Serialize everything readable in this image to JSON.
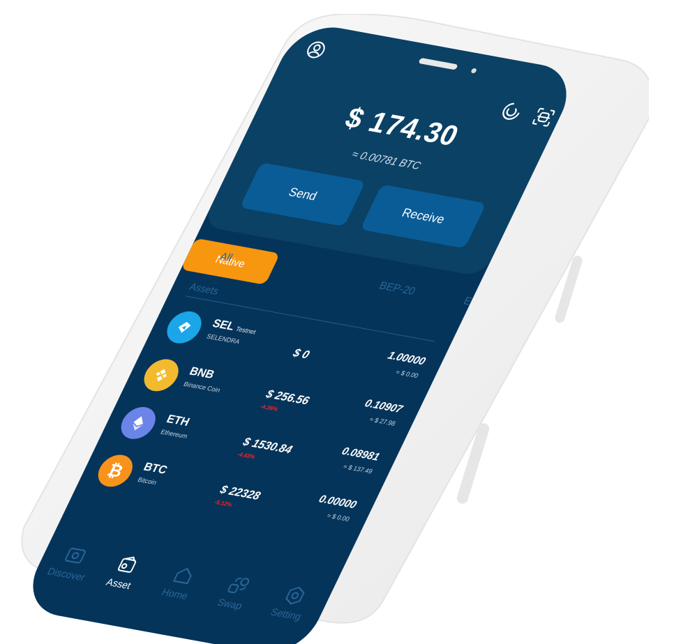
{
  "header": {
    "balance": "$ 174.30",
    "btc_equivalent": "≈ 0.00781 BTC"
  },
  "actions": {
    "send_label": "Send",
    "receive_label": "Receive"
  },
  "tabs": [
    {
      "label": "All",
      "active": false
    },
    {
      "label": "Native",
      "active": true
    },
    {
      "label": "BEP-20",
      "active": false
    },
    {
      "label": "ER",
      "active": false
    }
  ],
  "section_label": "Assets",
  "assets": [
    {
      "symbol": "SEL",
      "tag": "Testnet",
      "name": "SELENDRA",
      "price": "$ 0",
      "change": "",
      "amount": "1.00000",
      "value": "≈ $ 0.00",
      "icon": "selendra-icon",
      "color": "#1aa6e8"
    },
    {
      "symbol": "BNB",
      "tag": "",
      "name": "Binance Coin",
      "price": "$ 256.56",
      "change": "-4.26%",
      "amount": "0.10907",
      "value": "≈ $ 27.98",
      "icon": "binance-icon",
      "color": "#f3ba2f"
    },
    {
      "symbol": "ETH",
      "tag": "",
      "name": "Ethereum",
      "price": "$ 1530.84",
      "change": "-4.43%",
      "amount": "0.08981",
      "value": "≈ $ 137.49",
      "icon": "ethereum-icon",
      "color": "#6b84e8"
    },
    {
      "symbol": "BTC",
      "tag": "",
      "name": "Bitcoin",
      "price": "$ 22328",
      "change": "-5.12%",
      "amount": "0.00000",
      "value": "≈ $ 0.00",
      "icon": "bitcoin-icon",
      "color": "#f7931a"
    }
  ],
  "nav": [
    {
      "label": "Discover",
      "active": false
    },
    {
      "label": "Asset",
      "active": true
    },
    {
      "label": "Home",
      "active": false
    },
    {
      "label": "Swap",
      "active": false
    },
    {
      "label": "Setting",
      "active": false
    }
  ],
  "colors": {
    "screen_bg": "#05345a",
    "header_bg": "#0b4165",
    "button_bg": "#0a5c96",
    "accent": "#f7960f",
    "negative": "#ff2020"
  }
}
